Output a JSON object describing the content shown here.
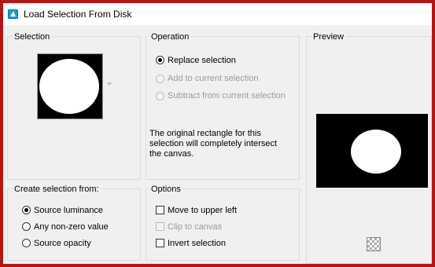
{
  "window": {
    "title": "Load Selection From Disk",
    "icon": "selection-app-icon"
  },
  "selection": {
    "group_title": "Selection"
  },
  "operation": {
    "group_title": "Operation",
    "options": [
      {
        "label": "Replace selection",
        "checked": true,
        "enabled": true
      },
      {
        "label": "Add to current selection",
        "checked": false,
        "enabled": false
      },
      {
        "label": "Subtract from current selection",
        "checked": false,
        "enabled": false
      }
    ],
    "note": "The original rectangle for this selection will completely intersect the canvas."
  },
  "preview": {
    "group_title": "Preview"
  },
  "create_from": {
    "group_title": "Create selection from:",
    "options": [
      {
        "label": "Source luminance",
        "checked": true
      },
      {
        "label": "Any non-zero value",
        "checked": false
      },
      {
        "label": "Source opacity",
        "checked": false
      }
    ]
  },
  "options": {
    "group_title": "Options",
    "items": [
      {
        "label": "Move to upper left",
        "checked": false,
        "enabled": true
      },
      {
        "label": "Clip to canvas",
        "checked": false,
        "enabled": false
      },
      {
        "label": "Invert selection",
        "checked": false,
        "enabled": true
      }
    ]
  },
  "colors": {
    "border": "#b01818",
    "background": "#f0f0f0"
  }
}
